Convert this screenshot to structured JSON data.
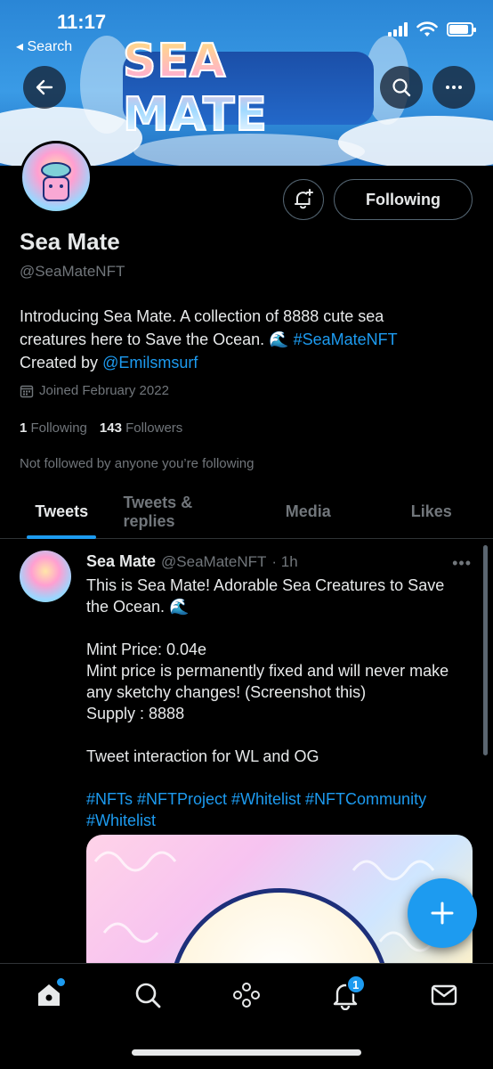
{
  "status_bar": {
    "time": "11:17",
    "back_label": "Search"
  },
  "banner": {
    "title": "SEA MATE"
  },
  "profile": {
    "display_name": "Sea Mate",
    "handle": "@SeaMateNFT",
    "bio_line1": "Introducing Sea Mate. A collection of 8888 cute sea",
    "bio_line2_text": "creatures here to Save the Ocean. 🌊 ",
    "bio_hashtag": "#SeaMateNFT",
    "bio_line3_text": "Created by ",
    "bio_mention": "@Emilsmsurf",
    "joined": "Joined February 2022",
    "following_count": "1",
    "following_label": "Following",
    "followers_count": "143",
    "followers_label": "Followers",
    "not_followed": "Not followed by anyone you’re following",
    "following_button": "Following"
  },
  "tabs": [
    {
      "label": "Tweets",
      "active": true
    },
    {
      "label": "Tweets & replies",
      "active": false
    },
    {
      "label": "Media",
      "active": false
    },
    {
      "label": "Likes",
      "active": false
    }
  ],
  "tweet": {
    "name": "Sea Mate",
    "handle": "@SeaMateNFT",
    "time": "· 1h",
    "text": "This is Sea Mate! Adorable Sea Creatures to Save the Ocean. 🌊\n\nMint Price: 0.04e\nMint price is permanently fixed and will never make any sketchy changes! (Screenshot this)\nSupply : 8888\n\nTweet interaction for WL and OG",
    "hashtags": "#NFTs #NFTProject #Whitelist #NFTCommunity #Whitelist"
  },
  "bottom_nav": {
    "notification_count": "1",
    "icons": [
      "home-icon",
      "search-icon",
      "spaces-icon",
      "bell-icon",
      "mail-icon"
    ]
  },
  "colors": {
    "accent": "#1d9bf0",
    "background": "#000000",
    "muted": "#71767b"
  }
}
